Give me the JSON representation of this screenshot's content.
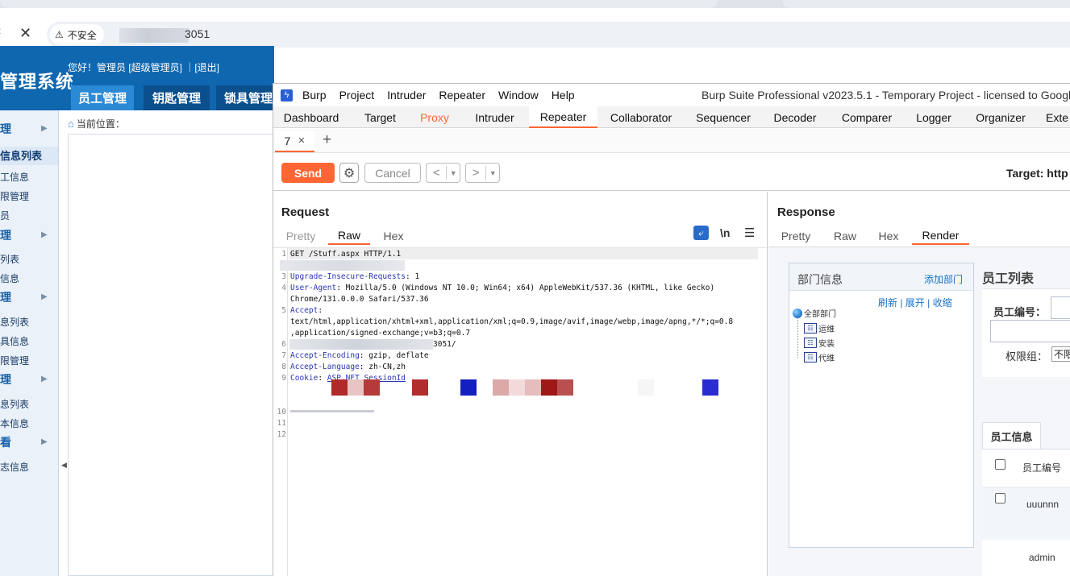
{
  "browser": {
    "security_label": "不安全",
    "url_visible": "3051"
  },
  "app": {
    "title": "管理系统",
    "greeting": "您好！管理员 [超级管理员] ｜[退出]",
    "nav_tabs": [
      "员工管理",
      "钥匙管理",
      "锁具管理"
    ],
    "breadcrumb": "当前位置：",
    "sidebar": [
      {
        "label": "理",
        "group": true
      },
      {
        "label": "信息列表",
        "active": true
      },
      {
        "label": "工信息"
      },
      {
        "label": "限管理"
      },
      {
        "label": "员"
      },
      {
        "label": "理",
        "group": true
      },
      {
        "label": "列表"
      },
      {
        "label": "信息"
      },
      {
        "label": "理",
        "group": true
      },
      {
        "label": "息列表"
      },
      {
        "label": "具信息"
      },
      {
        "label": "限管理"
      },
      {
        "label": "理",
        "group": true
      },
      {
        "label": "息列表"
      },
      {
        "label": "本信息"
      },
      {
        "label": "看",
        "group": true
      },
      {
        "label": "志信息"
      }
    ]
  },
  "burp": {
    "menu": [
      "Burp",
      "Project",
      "Intruder",
      "Repeater",
      "Window",
      "Help"
    ],
    "window_title": "Burp Suite Professional v2023.5.1 - Temporary Project - licensed to Google",
    "main_tabs": [
      "Dashboard",
      "Target",
      "Proxy",
      "Intruder",
      "Repeater",
      "Collaborator",
      "Sequencer",
      "Decoder",
      "Comparer",
      "Logger",
      "Organizer",
      "Exte"
    ],
    "active_main_tab": "Repeater",
    "repeater_tab": "7",
    "toolbar": {
      "send": "Send",
      "cancel": "Cancel",
      "target_label": "Target: http"
    },
    "request": {
      "title": "Request",
      "view_tabs": [
        "Pretty",
        "Raw",
        "Hex"
      ],
      "active_view": "Raw",
      "newline_icon_label": "\\n",
      "line1": "GET /Stuff.aspx HTTP/1.1",
      "line3_key": "Upgrade-Insecure-Requests",
      "line3_val": ": 1",
      "line4_key": "User-Agent",
      "line4_val": ": Mozilla/5.0 (Windows NT 10.0; Win64; x64) AppleWebKit/537.36 (KHTML, like Gecko)",
      "line4_cont": "Chrome/131.0.0.0 Safari/537.36",
      "line5_key": "Accept",
      "line5_val": ":",
      "line5_cont1": "text/html,application/xhtml+xml,application/xml;q=0.9,image/avif,image/webp,image/apng,*/*;q=0.8",
      "line5_cont2": ",application/signed-exchange;v=b3;q=0.7",
      "line6_tail": "3051/",
      "line7_key": "Accept-Encoding",
      "line7_val": ": gzip, deflate",
      "line8_key": "Accept-Language",
      "line8_val": ": zh-CN,zh",
      "line9_key": "Cookie",
      "line9_val": "ASP.NET_SessionId"
    },
    "response": {
      "title": "Response",
      "view_tabs": [
        "Pretty",
        "Raw",
        "Hex",
        "Render"
      ],
      "active_view": "Render",
      "render": {
        "dept_title": "部门信息",
        "add_dept": "添加部门",
        "tree_links": "刷新 | 展开 | 收缩",
        "tree": [
          "全部部门",
          "运维",
          "安装",
          "代维"
        ],
        "emp_list_title": "员工列表",
        "emp_no_label": "员工编号：",
        "perm_label": "权限组：",
        "perm_value": "不限",
        "emp_info_tab": "员工信息",
        "col_emp_no": "员工编号",
        "rows": [
          "uuunnn",
          "admin"
        ]
      }
    }
  }
}
